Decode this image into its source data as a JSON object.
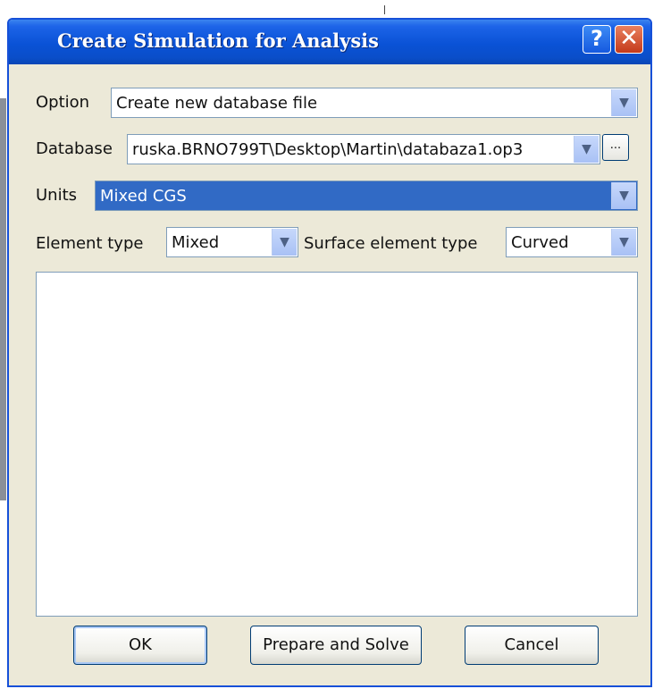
{
  "dialog": {
    "title": "Create Simulation for Analysis",
    "help_label": "?",
    "close_label": "✕"
  },
  "form": {
    "option": {
      "label": "Option",
      "value": "Create new database file"
    },
    "database": {
      "label": "Database",
      "value": "ruska.BRNO799T\\Desktop\\Martin\\databaza1.op3",
      "browse_label": "..."
    },
    "units": {
      "label": "Units",
      "value": "Mixed CGS"
    },
    "element_type": {
      "label": "Element type",
      "value": "Mixed"
    },
    "surface_element_type": {
      "label": "Surface element type",
      "value": "Curved"
    }
  },
  "buttons": {
    "ok": "OK",
    "prepare_and_solve": "Prepare and Solve",
    "cancel": "Cancel"
  },
  "icons": {
    "dropdown": "chevron-down-icon"
  },
  "colors": {
    "titlebar": "#0a52d6",
    "selection": "#316ac5",
    "window_bg": "#ece9d8"
  }
}
